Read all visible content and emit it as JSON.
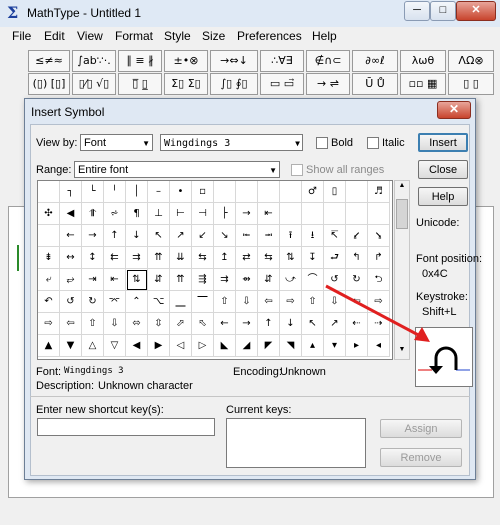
{
  "window": {
    "title": "MathType - Untitled 1",
    "minimize": "─",
    "maximize": "□",
    "close": "✕"
  },
  "menu": [
    "File",
    "Edit",
    "View",
    "Format",
    "Style",
    "Size",
    "Preferences",
    "Help"
  ],
  "palettes": {
    "row1": [
      "≤≠≈",
      "∫ab∵·.",
      "∥ ≡ ∦",
      "±•⊗",
      "→⇔↓",
      "∴∀∃",
      "∉∩⊂",
      "∂∞ℓ",
      "λωθ",
      "ΛΩ⊗"
    ],
    "row2": [
      "(▯) [▯]",
      "▯⁄▯ √▯",
      "▯̅ ▯̲",
      "Σ▯ Σ▯",
      "∫▯ ∮▯",
      "▭ ▭⃗",
      "→ ⇌",
      "Ū Ů",
      "▫▫ ▦",
      "▯ ▯"
    ]
  },
  "dialog": {
    "title": "Insert Symbol",
    "close": "✕",
    "view_by_label": "View by:",
    "view_by_value": "Font",
    "font_value": "Wingdings 3",
    "bold_label": "Bold",
    "italic_label": "Italic",
    "range_label": "Range:",
    "range_value": "Entire font",
    "show_all_ranges_label": "Show all ranges",
    "buttons": {
      "insert": "Insert",
      "close": "Close",
      "help": "Help",
      "assign": "Assign",
      "remove": "Remove"
    },
    "unicode_label": "Unicode:",
    "font_position_label": "Font position:",
    "font_position_value": "0x4C",
    "keystroke_label": "Keystroke:",
    "keystroke_value": "Shift+L",
    "font_info_label": "Font:",
    "font_info_value": "Wingdings 3",
    "encoding_label": "Encoding:",
    "encoding_value": "Unknown",
    "description_label": "Description:",
    "description_value": "Unknown character",
    "shortcut_label": "Enter new shortcut key(s):",
    "current_keys_label": "Current keys:",
    "selected_symbol": "⤾"
  },
  "symbols": [
    " ",
    "┐",
    "└",
    "╵",
    "│",
    "–",
    "•",
    "▫",
    "",
    "",
    "",
    "",
    "♂",
    "▯",
    "",
    "♬",
    "✣",
    "◀",
    "⥣",
    "⩫",
    "¶",
    "⊥",
    "⊢",
    "⊣",
    "├",
    "→",
    "⇤",
    "",
    "",
    "",
    "",
    "",
    "",
    "←",
    "→",
    "↑",
    "↓",
    "↖",
    "↗",
    "↙",
    "↘",
    "⭰",
    "⭲",
    "⭱",
    "⭳",
    "↸",
    "⭹",
    "⭸",
    "⇟",
    "↔",
    "↕",
    "⇇",
    "⇉",
    "⇈",
    "⇊",
    "⇆",
    "↥",
    "⇄",
    "⇆",
    "⇅",
    "↧",
    "⮐",
    "↰",
    "↱",
    "⤶",
    "⥂",
    "⇥",
    "⇤",
    "⇅",
    "⇵",
    "⇈",
    "⇶",
    "⇉",
    "⇴",
    "⇵",
    "⤻",
    "⌒",
    "↺",
    "↻",
    "⮌",
    "↶",
    "↺",
    "↻",
    "⌤",
    "⌃",
    "⌥",
    "⎽",
    "⎺",
    "⇧",
    "⇩",
    "⇦",
    "⇨",
    "⇧",
    "⇩",
    "⇦",
    "⇨",
    "⇨",
    "⇦",
    "⇧",
    "⇩",
    "⬄",
    "⇳",
    "⬀",
    "⬁",
    "←",
    "→",
    "↑",
    "↓",
    "↖",
    "↗",
    "⇠",
    "⇢",
    "▲",
    "▼",
    "△",
    "▽",
    "◀",
    "▶",
    "◁",
    "▷",
    "◣",
    "◢",
    "◤",
    "◥",
    "▴",
    "▾",
    "▸",
    "◂"
  ],
  "selected_index": 68
}
